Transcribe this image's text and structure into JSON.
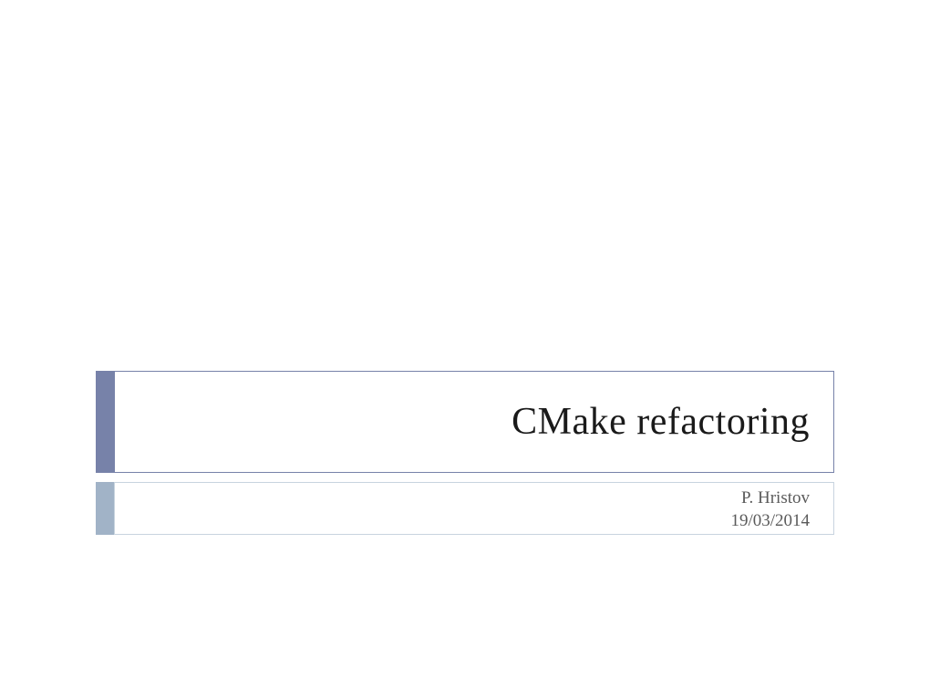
{
  "slide": {
    "title": "CMake refactoring",
    "author": "P. Hristov",
    "date": "19/03/2014"
  },
  "colors": {
    "title_accent": "#7782a9",
    "subtitle_accent": "#a1b3c7",
    "border_light": "#c8d4df",
    "text_dark": "#1a1a1a",
    "text_gray": "#5a5a5a"
  }
}
